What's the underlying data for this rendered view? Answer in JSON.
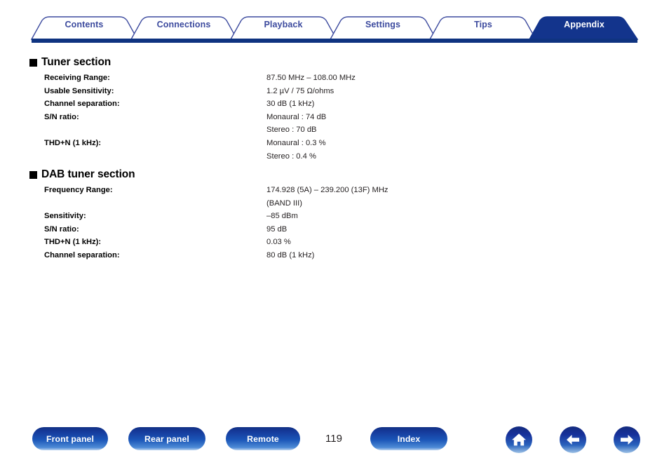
{
  "nav_tabs": {
    "items": [
      {
        "label": "Contents",
        "active": false
      },
      {
        "label": "Connections",
        "active": false
      },
      {
        "label": "Playback",
        "active": false
      },
      {
        "label": "Settings",
        "active": false
      },
      {
        "label": "Tips",
        "active": false
      },
      {
        "label": "Appendix",
        "active": true
      }
    ],
    "active_color": "#13348c",
    "inactive_text_color": "#3c4a9e",
    "active_text_color": "#ffffff",
    "outline_color": "#3c4a9e",
    "baseline_color": "#0f3380"
  },
  "sections": [
    {
      "heading": "Tuner section",
      "rows": [
        {
          "label": "Receiving Range:",
          "value": "87.50 MHz – 108.00 MHz"
        },
        {
          "label": "Usable Sensitivity:",
          "value": "1.2 µV / 75 Ω/ohms"
        },
        {
          "label": "Channel separation:",
          "value": "30 dB (1 kHz)"
        },
        {
          "label": "S/N ratio:",
          "value": "Monaural : 74 dB\nStereo : 70 dB"
        },
        {
          "label": "THD+N (1 kHz):",
          "value": "Monaural : 0.3 %\nStereo : 0.4 %"
        }
      ]
    },
    {
      "heading": "DAB tuner section",
      "rows": [
        {
          "label": "Frequency Range:",
          "value": "174.928 (5A) – 239.200 (13F) MHz\n(BAND III)"
        },
        {
          "label": "Sensitivity:",
          "value": "–85 dBm"
        },
        {
          "label": "S/N ratio:",
          "value": "95 dB"
        },
        {
          "label": "THD+N (1 kHz):",
          "value": "0.03 %"
        },
        {
          "label": "Channel separation:",
          "value": "80 dB (1 kHz)"
        }
      ]
    }
  ],
  "footer": {
    "buttons": [
      {
        "label": "Front panel"
      },
      {
        "label": "Rear panel"
      },
      {
        "label": "Remote"
      },
      {
        "label": "Index"
      }
    ],
    "page_number": "119",
    "icon_buttons": [
      {
        "name": "home-icon"
      },
      {
        "name": "arrow-left-icon"
      },
      {
        "name": "arrow-right-icon"
      }
    ]
  }
}
